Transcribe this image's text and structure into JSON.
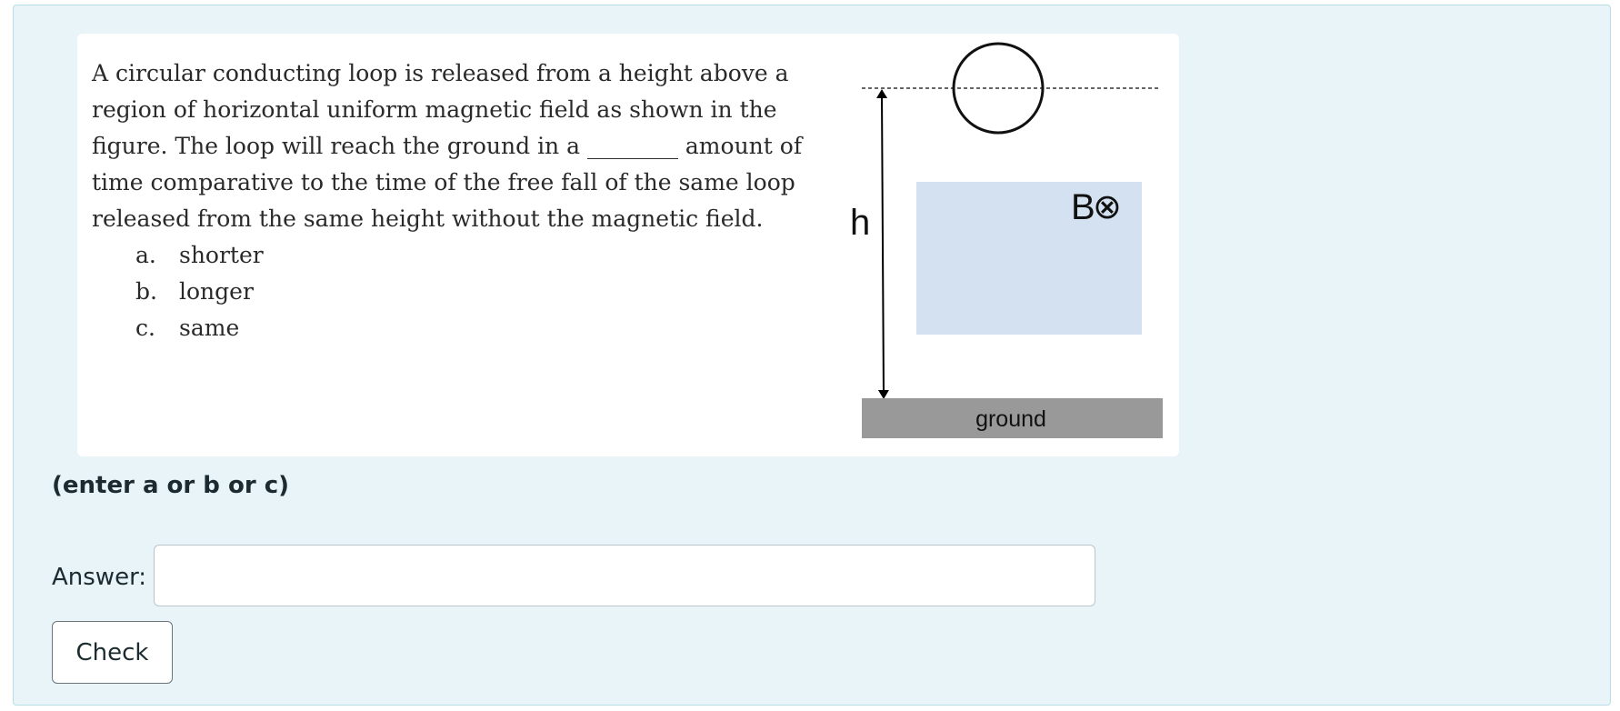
{
  "question": {
    "text": "A circular conducting loop is released from a height above a region of horizontal uniform magnetic field as shown in the figure. The loop will reach the ground in a ________ amount of time comparative to the time of the free fall of the same loop released from the same height without the magnetic field.",
    "options": [
      {
        "letter": "a.",
        "text": "shorter"
      },
      {
        "letter": "b.",
        "text": "longer"
      },
      {
        "letter": "c.",
        "text": "same"
      }
    ]
  },
  "figure": {
    "height_label": "h",
    "field_label": "B",
    "field_symbol": "⊗",
    "ground_label": "ground",
    "field_region_color": "#d4e1f0",
    "ground_color": "#999999"
  },
  "instruction": "(enter a or b or c)",
  "answer": {
    "label": "Answer:",
    "value": "",
    "placeholder": ""
  },
  "check_button_label": "Check"
}
